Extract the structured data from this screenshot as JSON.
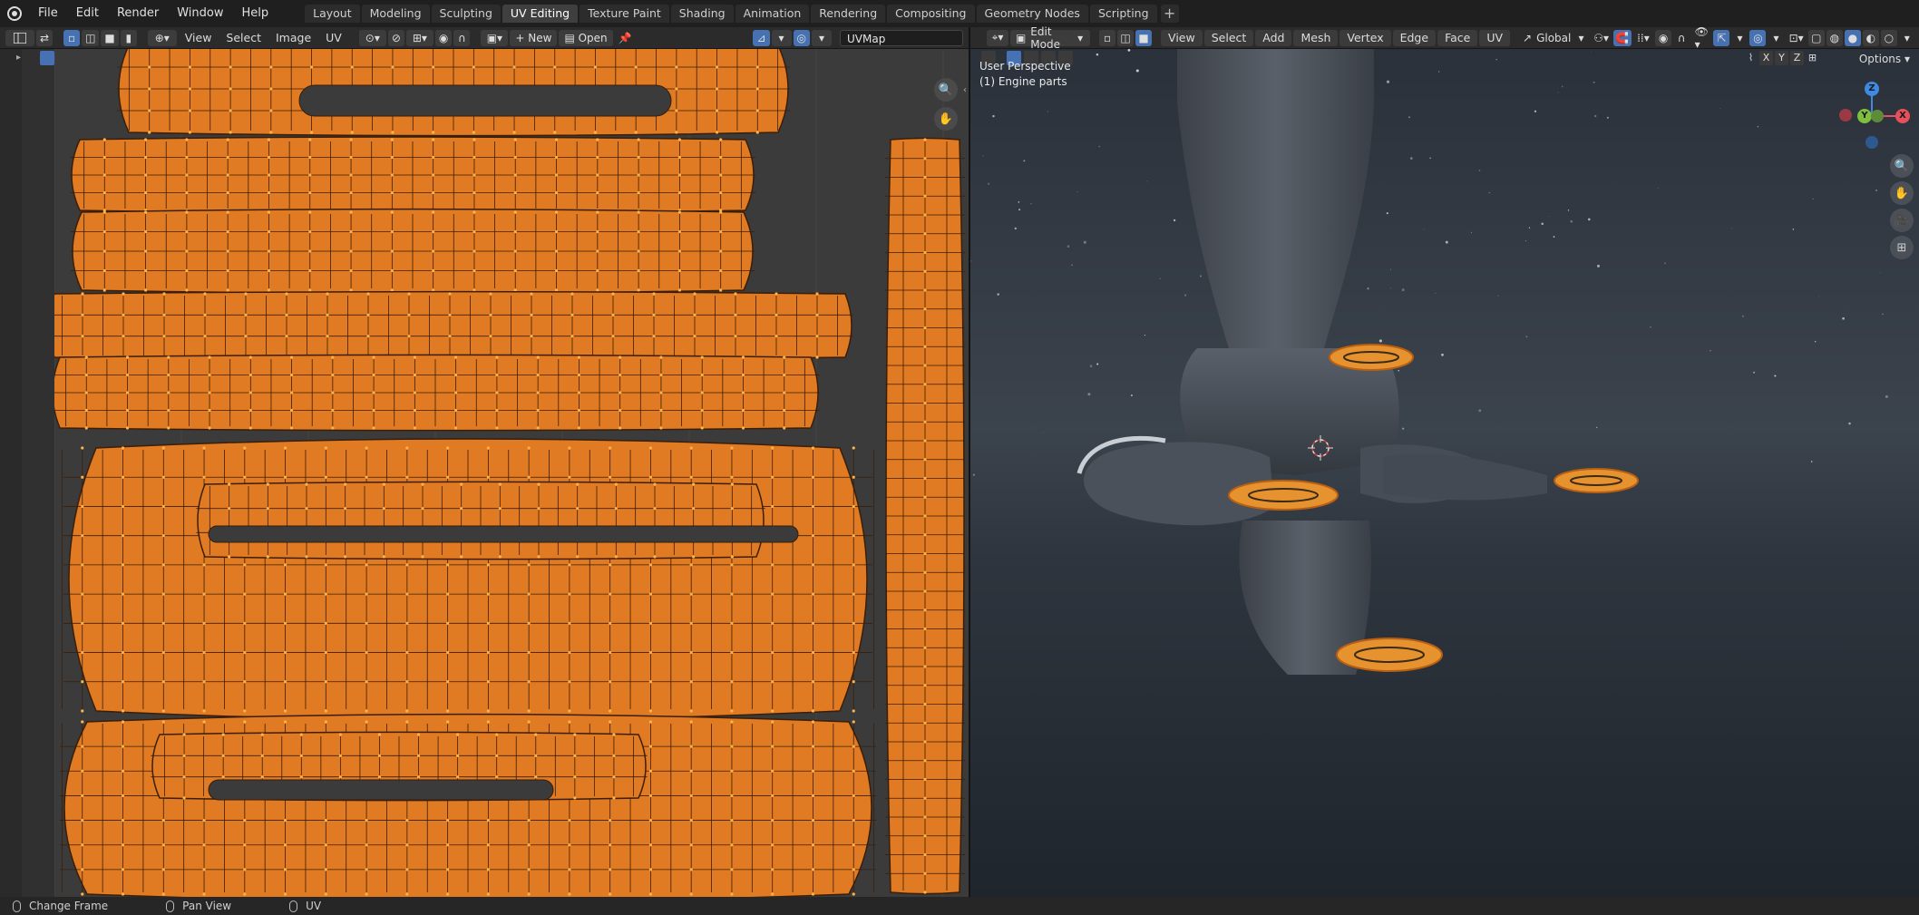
{
  "topbar": {
    "menus": [
      "File",
      "Edit",
      "Render",
      "Window",
      "Help"
    ],
    "workspaces": [
      "Layout",
      "Modeling",
      "Sculpting",
      "UV Editing",
      "Texture Paint",
      "Shading",
      "Animation",
      "Rendering",
      "Compositing",
      "Geometry Nodes",
      "Scripting"
    ],
    "active_workspace": "UV Editing",
    "add_label": "+"
  },
  "uv_editor": {
    "menus": [
      "View",
      "Select",
      "Image",
      "UV"
    ],
    "new_label": "New",
    "open_label": "Open",
    "uvmap_value": "UVMap",
    "island_color": "#e07a23",
    "edge_color": "#3a1e08",
    "vertex_color": "#ffb347"
  },
  "viewport": {
    "mode": "Edit Mode",
    "menus": [
      "View",
      "Select",
      "Add",
      "Mesh",
      "Vertex",
      "Edge",
      "Face",
      "UV"
    ],
    "orientation": "Global",
    "perspective_label": "User Perspective",
    "object_label": "(1) Engine parts",
    "options_label": "Options",
    "mirror_axes": [
      "X",
      "Y",
      "Z"
    ],
    "gizmo_axes": {
      "x": "X",
      "y": "Y",
      "z": "Z"
    },
    "axis_colors": {
      "x": "#e6505d",
      "y": "#7fbf3f",
      "z": "#3d8ae0"
    }
  },
  "statusbar": {
    "items": [
      "Change Frame",
      "Pan View",
      "UV"
    ]
  }
}
